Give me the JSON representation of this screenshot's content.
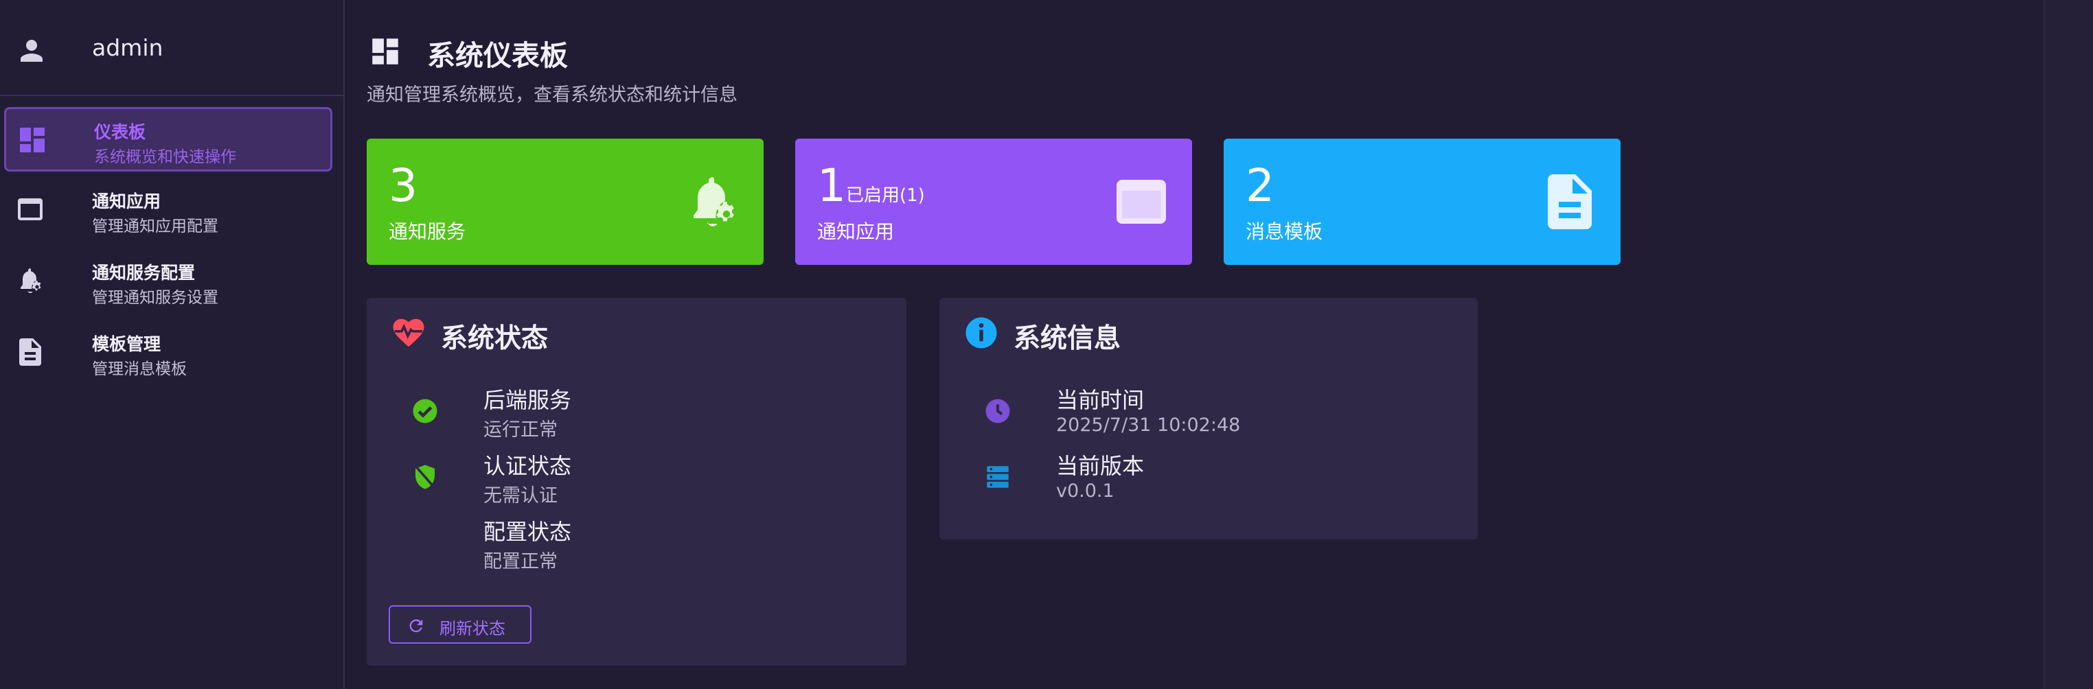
{
  "user": {
    "name": "admin",
    "icon": "person-icon"
  },
  "sidebar": {
    "items": [
      {
        "title": "仪表板",
        "subtitle": "系统概览和快速操作",
        "icon": "dashboard-icon",
        "active": true
      },
      {
        "title": "通知应用",
        "subtitle": "管理通知应用配置",
        "icon": "app-window-icon",
        "active": false
      },
      {
        "title": "通知服务配置",
        "subtitle": "管理通知服务设置",
        "icon": "bell-gear-icon",
        "active": false
      },
      {
        "title": "模板管理",
        "subtitle": "管理消息模板",
        "icon": "document-icon",
        "active": false
      }
    ]
  },
  "header": {
    "title": "系统仪表板",
    "subtitle": "通知管理系统概览，查看系统状态和统计信息",
    "icon": "dashboard-icon"
  },
  "stats": [
    {
      "value": "3",
      "suffix": "",
      "label": "通知服务",
      "color": "#52c41a",
      "icon": "bell-gear-icon"
    },
    {
      "value": "1",
      "suffix": "已启用(1)",
      "label": "通知应用",
      "color": "#9254f5",
      "icon": "app-window-icon"
    },
    {
      "value": "2",
      "suffix": "",
      "label": "消息模板",
      "color": "#1aacfa",
      "icon": "document-icon"
    }
  ],
  "system_status": {
    "title": "系统状态",
    "icon": "heart-pulse-icon",
    "rows": [
      {
        "title": "后端服务",
        "subtitle": "运行正常",
        "icon": "check-circle-icon"
      },
      {
        "title": "认证状态",
        "subtitle": "无需认证",
        "icon": "shield-icon"
      },
      {
        "title": "配置状态",
        "subtitle": "配置正常",
        "icon": ""
      }
    ],
    "refresh_label": "刷新状态"
  },
  "system_info": {
    "title": "系统信息",
    "icon": "info-circle-icon",
    "rows": [
      {
        "title": "当前时间",
        "subtitle": "2025/7/31 10:02:48",
        "icon": "clock-icon"
      },
      {
        "title": "当前版本",
        "subtitle": "v0.0.1",
        "icon": "server-icon"
      }
    ]
  },
  "colors": {
    "accent": "#8b5cf6",
    "success": "#52c41a",
    "background": "#211c33",
    "panel": "#2f2847"
  }
}
